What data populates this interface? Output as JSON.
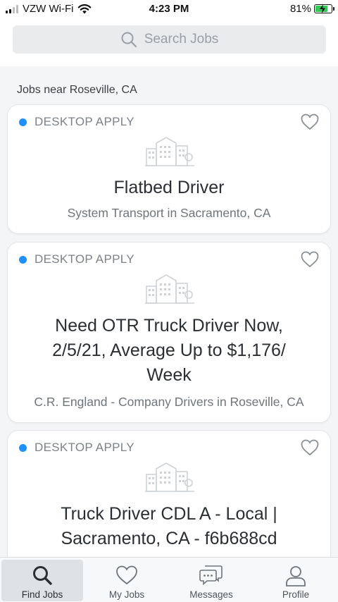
{
  "status_bar": {
    "carrier": "VZW Wi-Fi",
    "time": "4:23 PM",
    "battery_percent": "81%",
    "battery_level": 0.81,
    "battery_color": "#34c759"
  },
  "search": {
    "placeholder": "Search Jobs",
    "icon": "search-icon"
  },
  "section_label": "Jobs near Roseville, CA",
  "jobs": [
    {
      "apply_label": "DESKTOP APPLY",
      "title_lines": [
        "Flatbed Driver"
      ],
      "subtitle": "System Transport in Sacramento, CA"
    },
    {
      "apply_label": "DESKTOP APPLY",
      "title_lines": [
        "Need OTR Truck Driver Now,",
        "2/5/21, Average Up to $1,176/",
        "Week"
      ],
      "subtitle": "C.R. England - Company Drivers in Roseville, CA"
    },
    {
      "apply_label": "DESKTOP APPLY",
      "title_lines": [
        "Truck Driver CDL A - Local |",
        "Sacramento, CA - f6b688cd"
      ],
      "subtitle": ""
    }
  ],
  "tabs": [
    {
      "label": "Find Jobs",
      "icon": "search-icon",
      "active": true
    },
    {
      "label": "My Jobs",
      "icon": "heart-icon",
      "active": false
    },
    {
      "label": "Messages",
      "icon": "messages-icon",
      "active": false
    },
    {
      "label": "Profile",
      "icon": "person-icon",
      "active": false
    }
  ],
  "colors": {
    "accent_dot": "#1e90ff",
    "background": "#f4f5f6",
    "card": "#ffffff"
  }
}
